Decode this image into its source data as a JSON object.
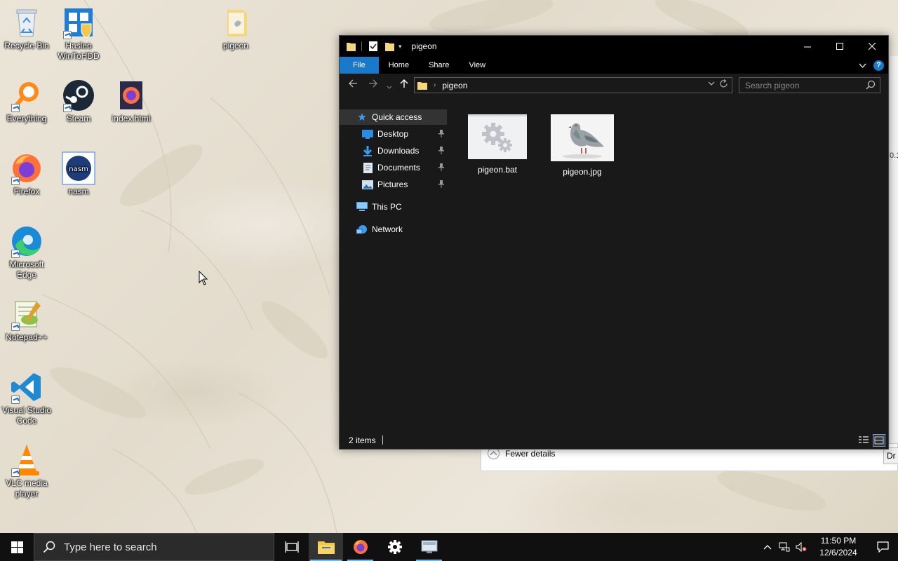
{
  "desktop": {
    "icons": [
      {
        "label": "Recycle Bin"
      },
      {
        "label": "Hasleo WinToHDD"
      },
      {
        "label": "pigeon"
      },
      {
        "label": "Everything"
      },
      {
        "label": "Steam"
      },
      {
        "label": "index.html"
      },
      {
        "label": "Firefox"
      },
      {
        "label": "nasm"
      },
      {
        "label": "Microsoft Edge"
      },
      {
        "label": "Notepad++"
      },
      {
        "label": "Visual Studio Code"
      },
      {
        "label": "VLC media player"
      }
    ],
    "nasm_badge": "nasm"
  },
  "background_dialog": {
    "fewer_details": "Fewer details",
    "button_partial": "Dr",
    "edge_partial": "0.1"
  },
  "explorer": {
    "title": "pigeon",
    "ribbon_tabs": [
      "File",
      "Home",
      "Share",
      "View"
    ],
    "help": "?",
    "address_path": "pigeon",
    "search_placeholder": "Search pigeon",
    "nav_pane": {
      "quick_access": "Quick access",
      "pinned": [
        "Desktop",
        "Downloads",
        "Documents",
        "Pictures"
      ],
      "this_pc": "This PC",
      "network": "Network"
    },
    "files": [
      {
        "name": "pigeon.bat",
        "icon": "gears-icon"
      },
      {
        "name": "pigeon.jpg",
        "icon": "pigeon-photo"
      }
    ],
    "status": {
      "item_count": "2 items"
    },
    "accent": "#1979ca"
  },
  "taskbar": {
    "search_placeholder": "Type here to search",
    "apps": [
      "task-view",
      "file-explorer",
      "firefox",
      "settings",
      "remote"
    ],
    "clock": {
      "time": "11:50 PM",
      "date": "12/6/2024"
    }
  }
}
